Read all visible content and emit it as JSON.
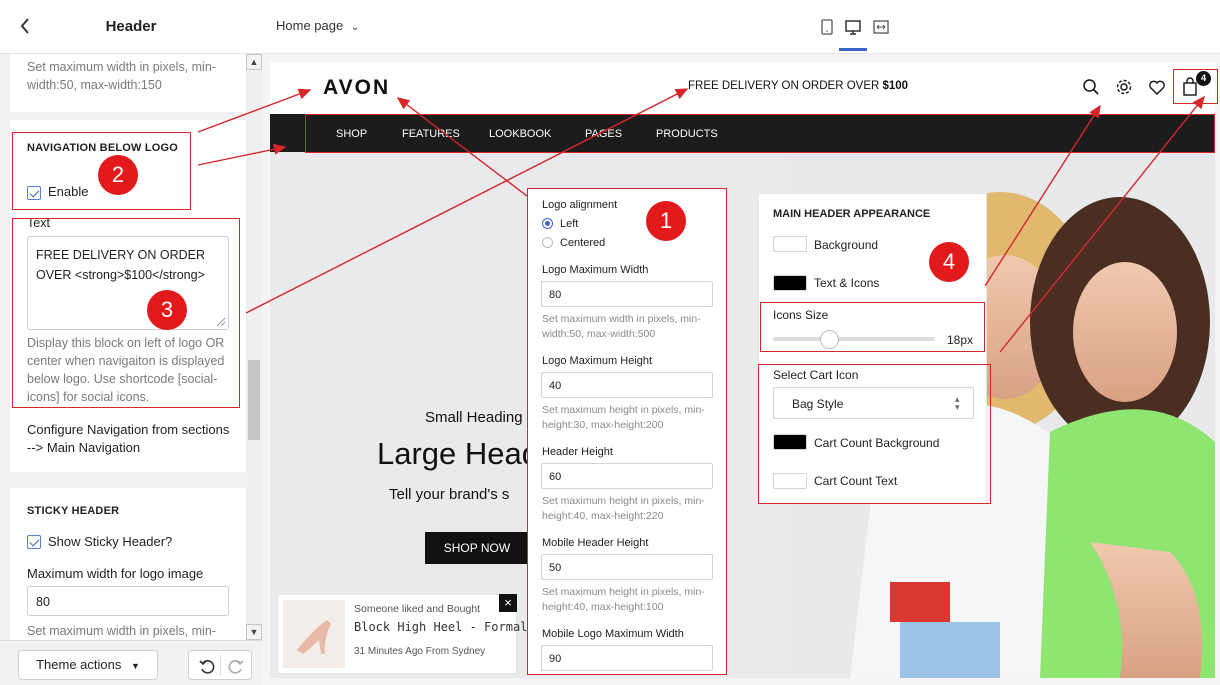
{
  "sidebar": {
    "back_icon": "chevron-left-icon",
    "title": "Header",
    "top_help": "Set maximum width in pixels, min-width:50, max-width:150",
    "nav_below": {
      "title": "NAVIGATION BELOW LOGO",
      "enable_label": "Enable",
      "text_label": "Text",
      "text_value_line1": "FREE DELIVERY ON ORDER",
      "text_value_line2": "OVER <strong>$100</strong>",
      "help": "Display this block on left of logo OR center when navigaiton is displayed below logo. Use shortcode [social-icons] for social icons.",
      "configure": "Configure Navigation from sections --> Main Navigation"
    },
    "sticky": {
      "title": "STICKY HEADER",
      "show_label": "Show Sticky Header?",
      "max_width_label": "Maximum width for logo image",
      "max_width_value": "80",
      "help": "Set maximum width in pixels, min-"
    },
    "footer": {
      "theme_actions": "Theme actions",
      "undo_icon": "undo-icon",
      "redo_icon": "redo-icon"
    }
  },
  "topbar": {
    "page": "Home page",
    "devices": [
      "mobile-icon",
      "desktop-icon",
      "fullwidth-icon"
    ]
  },
  "store": {
    "logo": "AVON",
    "delivery_prefix": "FREE DELIVERY ON ORDER OVER ",
    "delivery_amount": "$100",
    "nav": [
      "SHOP",
      "FEATURES",
      "LOOKBOOK",
      "PAGES",
      "PRODUCTS"
    ],
    "cart_count": "4",
    "hero": {
      "small_heading": "Small Heading",
      "large_heading": "Large Head",
      "text": "Tell your brand's s",
      "button": "SHOP NOW"
    },
    "popup": {
      "line1": "Someone liked and Bought",
      "line2": "Block High Heel - Formal",
      "line3": "31 Minutes Ago From Sydney",
      "close": "×"
    }
  },
  "panel1": {
    "logo_alignment": "Logo alignment",
    "left": "Left",
    "centered": "Centered",
    "logo_max_width": "Logo Maximum Width",
    "logo_max_width_value": "80",
    "logo_max_width_help": "Set maximum width in pixels, min-width:50, max-width:500",
    "logo_max_height": "Logo Maximum Height",
    "logo_max_height_value": "40",
    "logo_max_height_help": "Set maximum height in pixels, min-height:30, max-height:200",
    "header_height": "Header Height",
    "header_height_value": "60",
    "header_height_help": "Set maximum height in pixels, min-height:40, max-height:220",
    "mobile_header_height": "Mobile Header Height",
    "mobile_header_height_value": "50",
    "mobile_header_height_help": "Set maximum height in pixels, min-height:40, max-height:100",
    "mobile_logo_max_width": "Mobile Logo Maximum Width",
    "mobile_logo_max_width_value": "90"
  },
  "panel2": {
    "title": "MAIN HEADER APPEARANCE",
    "background": "Background",
    "text_icons": "Text & Icons",
    "icons_size": "Icons Size",
    "icons_size_value": "18px",
    "select_cart_icon": "Select Cart Icon",
    "cart_icon_value": "Bag Style",
    "cart_count_bg": "Cart Count Background",
    "cart_count_text": "Cart Count Text"
  },
  "badges": [
    "1",
    "2",
    "3",
    "4"
  ],
  "colors": {
    "annotation_red": "#e31a1c",
    "nav_bg": "#1c1c1c",
    "accent_blue": "#3d63c9"
  }
}
